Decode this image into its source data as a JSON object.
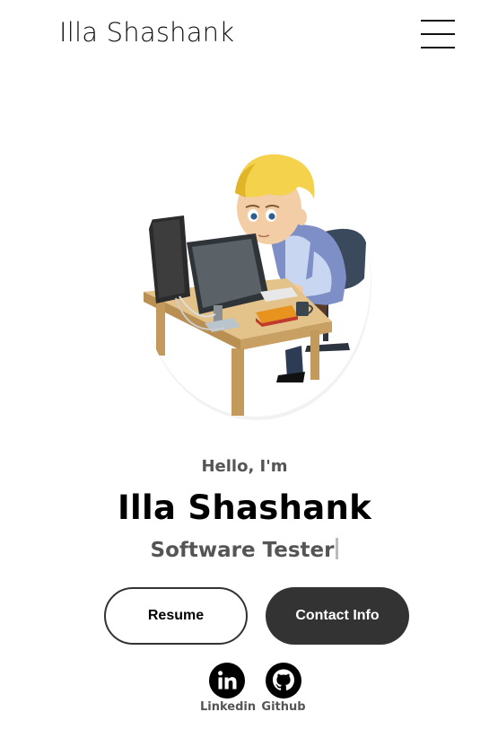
{
  "header": {
    "brand": "Illa Shashank",
    "menu_icon": "hamburger-menu-icon"
  },
  "hero": {
    "avatar_alt": "cartoon-developer-at-desk",
    "greeting": "Hello, I'm",
    "name": "Illa Shashank",
    "role": "Software Tester"
  },
  "actions": {
    "resume_label": "Resume",
    "contact_label": "Contact Info"
  },
  "social": {
    "linkedin_label": "Linkedin",
    "github_label": "Github",
    "linkedin_icon": "linkedin-icon",
    "github_icon": "github-icon"
  },
  "colors": {
    "text": "#000000",
    "muted": "#555555",
    "button_dark": "#333333",
    "background": "#ffffff"
  }
}
